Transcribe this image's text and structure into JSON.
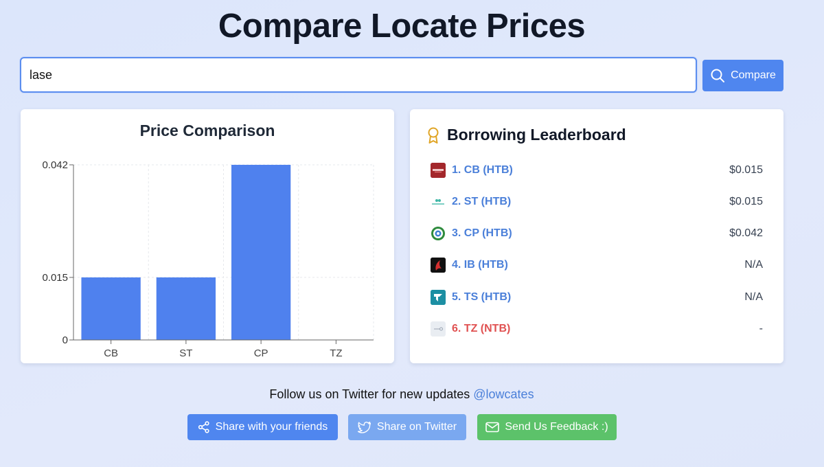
{
  "page": {
    "title": "Compare Locate Prices"
  },
  "search": {
    "value": "lase",
    "button_label": "Compare"
  },
  "chart": {
    "title": "Price Comparison"
  },
  "chart_data": {
    "type": "bar",
    "categories": [
      "CB",
      "ST",
      "CP",
      "TZ"
    ],
    "values": [
      0.015,
      0.015,
      0.042,
      0
    ],
    "title": "Price Comparison",
    "xlabel": "",
    "ylabel": "",
    "ylim": [
      0,
      0.042
    ],
    "yticks": [
      "0",
      "0.015",
      "0.042"
    ],
    "grid": true,
    "bar_color": "#4f81ee"
  },
  "leaderboard": {
    "title": "Borrowing Leaderboard",
    "icon": "award-icon",
    "items": [
      {
        "label": "1. CB (HTB)",
        "price": "$0.015",
        "type": "HTB",
        "logo": "cb-logo"
      },
      {
        "label": "2. ST (HTB)",
        "price": "$0.015",
        "type": "HTB",
        "logo": "st-logo"
      },
      {
        "label": "3. CP (HTB)",
        "price": "$0.042",
        "type": "HTB",
        "logo": "cp-logo"
      },
      {
        "label": "4. IB (HTB)",
        "price": "N/A",
        "type": "HTB",
        "logo": "ib-logo"
      },
      {
        "label": "5. TS (HTB)",
        "price": "N/A",
        "type": "HTB",
        "logo": "ts-logo"
      },
      {
        "label": "6. TZ (NTB)",
        "price": "-",
        "type": "NTB",
        "logo": "tz-logo"
      }
    ]
  },
  "footer": {
    "follow_text": "Follow us on Twitter for new updates",
    "handle": "@lowcates",
    "share_label": "Share with your friends",
    "twitter_label": "Share on Twitter",
    "feedback_label": "Send Us Feedback :)"
  },
  "colors": {
    "accent": "#4f86ef",
    "link": "#4a7fd9",
    "ntb": "#e05252",
    "feedback": "#5cc26a",
    "twitter_button": "#7aa8f0"
  }
}
